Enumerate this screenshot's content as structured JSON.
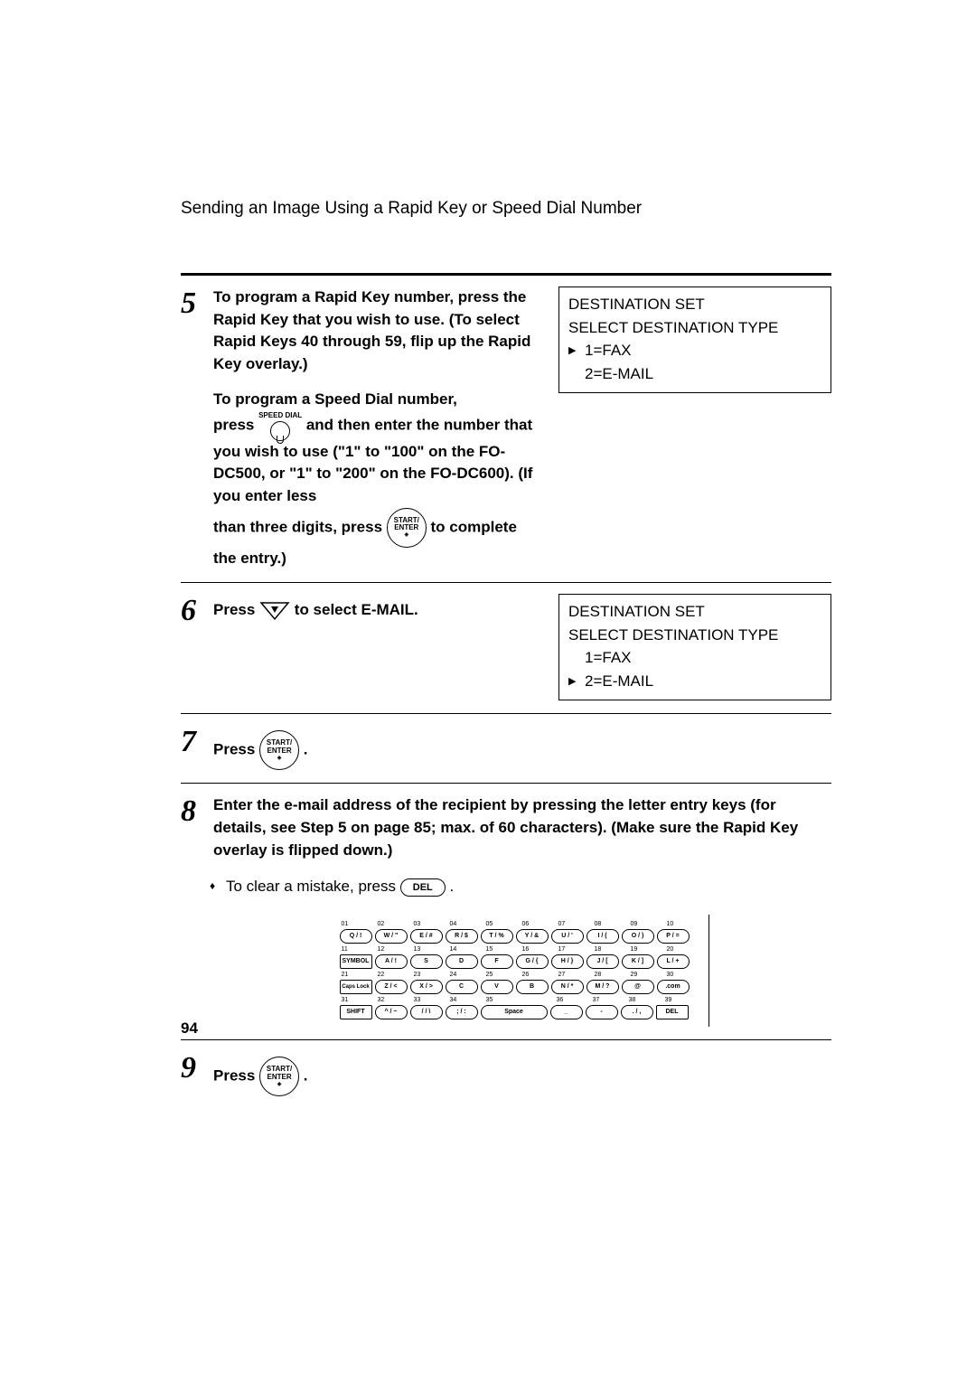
{
  "header": "Sending an Image Using a Rapid Key or Speed Dial Number",
  "page_number": "94",
  "step5": {
    "num": "5",
    "para1a": "To program a Rapid Key number, press the Rapid Key that you wish to use. (To select Rapid Keys 40 through 59, flip up the Rapid Key overlay.)",
    "para2a": "To program a Speed Dial number,",
    "para2b": "press ",
    "speed_dial_label": "SPEED DIAL",
    "para2c": " and then enter the number that you wish to use (\"1\" to \"100\" on the FO-DC500, or \"1\" to \"200\" on the FO-DC600). (If you enter less",
    "para3a": "than three digits, press ",
    "enter_line1": "START/",
    "enter_line2": "ENTER",
    "para3b": " to complete the entry.)",
    "display": {
      "l1": "DESTINATION SET",
      "l2": "SELECT DESTINATION TYPE",
      "l3": "1=FAX",
      "l4": "2=E-MAIL"
    }
  },
  "step6": {
    "num": "6",
    "text_a": "Press ",
    "text_b": " to select E-MAIL.",
    "display": {
      "l1": "DESTINATION SET",
      "l2": "SELECT DESTINATION TYPE",
      "l3": "1=FAX",
      "l4": "2=E-MAIL"
    }
  },
  "step7": {
    "num": "7",
    "text_a": "Press ",
    "text_b": "."
  },
  "step8": {
    "num": "8",
    "text": "Enter the e-mail address of the recipient by pressing the letter entry keys (for details, see Step 5 on page 85; max. of 60 characters). (Make sure the Rapid Key overlay is flipped down.)",
    "bullet_a": "To clear a mistake, press ",
    "del_label": "DEL",
    "bullet_b": " ."
  },
  "step9": {
    "num": "9",
    "text_a": "Press ",
    "text_b": "."
  },
  "keyboard": {
    "nums1": [
      "01",
      "02",
      "03",
      "04",
      "05",
      "06",
      "07",
      "08",
      "09",
      "10"
    ],
    "row1": [
      "Q / !",
      "W / \"",
      "E / #",
      "R / $",
      "T / %",
      "Y / &",
      "U / '",
      "I / (",
      "O / )",
      "P / ="
    ],
    "nums2": [
      "11",
      "12",
      "13",
      "14",
      "15",
      "16",
      "17",
      "18",
      "19",
      "20"
    ],
    "row2": [
      "SYMBOL",
      "A / !",
      "S",
      "D",
      "F",
      "G / {",
      "H / }",
      "J / [",
      "K / ]",
      "L / +"
    ],
    "nums3": [
      "21",
      "22",
      "23",
      "24",
      "25",
      "26",
      "27",
      "28",
      "29",
      "30"
    ],
    "row3": [
      "Caps Lock",
      "Z / <",
      "X / >",
      "C",
      "V",
      "B",
      "N / *",
      "M / ?",
      "@",
      ".com"
    ],
    "nums4": [
      "31",
      "32",
      "33",
      "34",
      "35",
      "",
      "36",
      "37",
      "38",
      "39"
    ],
    "row4": [
      "SHIFT",
      "^ / ~",
      "/ / \\",
      "; / :",
      "Space",
      "_",
      "-",
      ". / ,",
      "DEL"
    ]
  }
}
